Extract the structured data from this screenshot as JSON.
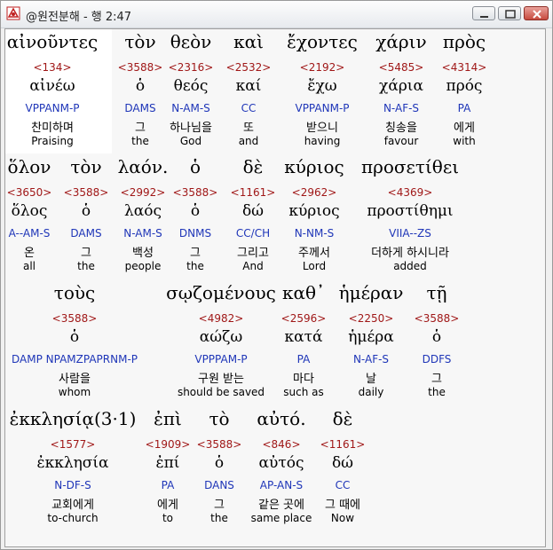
{
  "window": {
    "title": "@원전분해 - 행 2:47"
  },
  "rows": [
    [
      {
        "greek": "αἰνοῦντες",
        "strong": "<134>",
        "lemma": "αἰνέω",
        "parse": "VPPANM-P",
        "korean": "찬미하며",
        "english": "Praising"
      },
      {
        "greek": "τὸν",
        "strong": "<3588>",
        "lemma": "ὁ",
        "parse": "DAMS",
        "korean": "그",
        "english": "the"
      },
      {
        "greek": "θεὸν",
        "strong": "<2316>",
        "lemma": "θεός",
        "parse": "N-AM-S",
        "korean": "하나님을",
        "english": "God"
      },
      {
        "greek": "καὶ",
        "strong": "<2532>",
        "lemma": "καί",
        "parse": "CC",
        "korean": "또",
        "english": "and"
      },
      {
        "greek": "ἔχοντες",
        "strong": "<2192>",
        "lemma": "ἔχω",
        "parse": "VPPANM-P",
        "korean": "받으니",
        "english": "having"
      },
      {
        "greek": "χάριν",
        "strong": "<5485>",
        "lemma": "χάρια",
        "parse": "N-AF-S",
        "korean": "칭송을",
        "english": "favour"
      },
      {
        "greek": "πρὸς",
        "strong": "<4314>",
        "lemma": "πρός",
        "parse": "PA",
        "korean": "에게",
        "english": "with"
      }
    ],
    [
      {
        "greek": "ὅλον",
        "strong": "<3650>",
        "lemma": "ὅλος",
        "parse": "A--AM-S",
        "korean": "온",
        "english": "all"
      },
      {
        "greek": "τὸν",
        "strong": "<3588>",
        "lemma": "ὁ",
        "parse": "DAMS",
        "korean": "그",
        "english": "the"
      },
      {
        "greek": "λαόν.",
        "strong": "<2992>",
        "lemma": "λαός",
        "parse": "N-AM-S",
        "korean": "백성",
        "english": "people"
      },
      {
        "greek": "ὁ",
        "strong": "<3588>",
        "lemma": "ὁ",
        "parse": "DNMS",
        "korean": "그",
        "english": "the"
      },
      {
        "greek": "δὲ",
        "strong": "<1161>",
        "lemma": "δώ",
        "parse": "CC/CH",
        "korean": "그리고",
        "english": "And"
      },
      {
        "greek": "κύριος",
        "strong": "<2962>",
        "lemma": "κύριος",
        "parse": "N-NM-S",
        "korean": "주께서",
        "english": "Lord"
      },
      {
        "greek": "προσετίθει",
        "strong": "<4369>",
        "lemma": "προστίθημι",
        "parse": "VIIA--ZS",
        "korean": "더하게 하시니라",
        "english": "added"
      }
    ],
    [
      {
        "greek": "τοὺς",
        "strong": "<3588>",
        "lemma": "ὁ",
        "parse": "DAMP NPAMZPAPRNM-P",
        "korean": "사람을",
        "english": "whom"
      },
      {
        "greek": "σῳζομένους",
        "strong": "<4982>",
        "lemma": "αώζω",
        "parse": "VPPPAM-P",
        "korean": "구원 받는",
        "english": "should be saved"
      },
      {
        "greek": "καθ᾽",
        "strong": "<2596>",
        "lemma": "κατά",
        "parse": "PA",
        "korean": "마다",
        "english": "such as"
      },
      {
        "greek": "ἡμέραν",
        "strong": "<2250>",
        "lemma": "ἡμέρα",
        "parse": "N-AF-S",
        "korean": "날",
        "english": "daily"
      },
      {
        "greek": "τῇ",
        "strong": "<3588>",
        "lemma": "ὁ",
        "parse": "DDFS",
        "korean": "그",
        "english": "the"
      }
    ],
    [
      {
        "greek": "ἐκκλησίᾳ(3·1)",
        "strong": "<1577>",
        "lemma": "ἐκκλησία",
        "parse": "N-DF-S",
        "korean": "교회에게",
        "english": "to-church"
      },
      {
        "greek": "ἐπὶ",
        "strong": "<1909>",
        "lemma": "ἐπί",
        "parse": "PA",
        "korean": "에게",
        "english": "to"
      },
      {
        "greek": "τὸ",
        "strong": "<3588>",
        "lemma": "ὁ",
        "parse": "DANS",
        "korean": "그",
        "english": "the"
      },
      {
        "greek": "αὐτό.",
        "strong": "<846>",
        "lemma": "αὐτός",
        "parse": "AP-AN-S",
        "korean": "같은 곳에",
        "english": "same place"
      },
      {
        "greek": "δὲ",
        "strong": "<1161>",
        "lemma": "δώ",
        "parse": "CC",
        "korean": "그 때에",
        "english": "Now"
      }
    ]
  ]
}
